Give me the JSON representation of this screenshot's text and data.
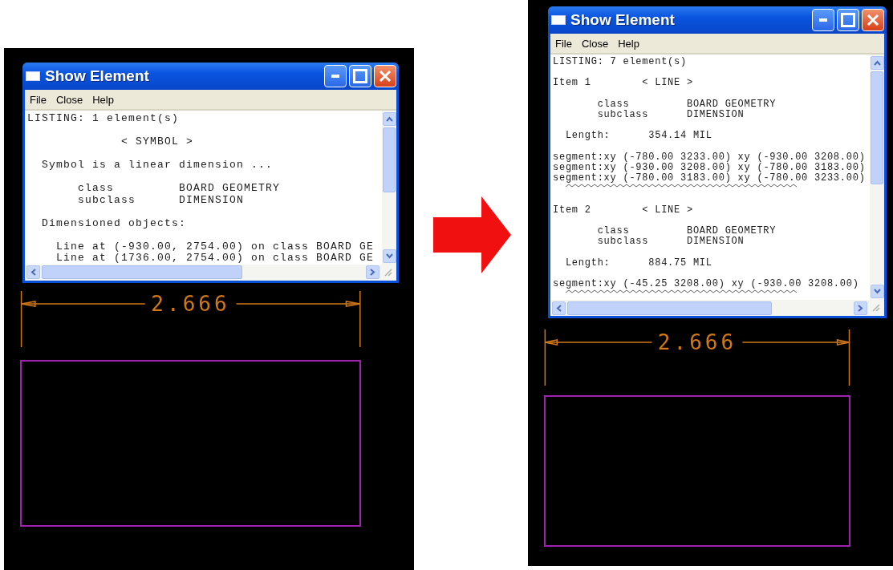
{
  "panels": [
    {
      "window": {
        "title": "Show Element",
        "menu": [
          "File",
          "Close",
          "Help"
        ],
        "lines": [
          {
            "kind": "plain",
            "text": "LISTING: 1 element(s)"
          },
          {
            "kind": "blank"
          },
          {
            "kind": "center",
            "text": "< SYMBOL >"
          },
          {
            "kind": "blank"
          },
          {
            "kind": "note",
            "text": "Symbol is a linear dimension ..."
          },
          {
            "kind": "blank"
          },
          {
            "kind": "pair",
            "label": "class",
            "value": "BOARD GEOMETRY"
          },
          {
            "kind": "pair",
            "label": "subclass",
            "value": "DIMENSION"
          },
          {
            "kind": "blank"
          },
          {
            "kind": "note",
            "text": "Dimensioned objects:"
          },
          {
            "kind": "blank"
          },
          {
            "kind": "deep",
            "text": "Line at (-930.00, 2754.00) on class BOARD GE"
          },
          {
            "kind": "deep",
            "text": "Line at (1736.00, 2754.00) on class BOARD GE"
          }
        ]
      },
      "dimension": "2.666"
    },
    {
      "window": {
        "title": "Show Element",
        "menu": [
          "File",
          "Close",
          "Help"
        ],
        "lines": [
          {
            "kind": "plain",
            "text": "LISTING: 7 element(s)"
          },
          {
            "kind": "blank"
          },
          {
            "kind": "item",
            "label": "Item 1",
            "tag": "< LINE >"
          },
          {
            "kind": "blank"
          },
          {
            "kind": "pair",
            "label": "class",
            "value": "BOARD GEOMETRY"
          },
          {
            "kind": "pair",
            "label": "subclass",
            "value": "DIMENSION"
          },
          {
            "kind": "blank"
          },
          {
            "kind": "measure",
            "label": "Length:",
            "value": "354.14 MIL"
          },
          {
            "kind": "blank"
          },
          {
            "kind": "plain",
            "text": "segment:xy (-780.00 3233.00) xy (-930.00 3208.00)"
          },
          {
            "kind": "plain",
            "text": "segment:xy (-930.00 3208.00) xy (-780.00 3183.00)"
          },
          {
            "kind": "plain",
            "text": "segment:xy (-780.00 3183.00) xy (-780.00 3233.00)"
          },
          {
            "kind": "squiggle"
          },
          {
            "kind": "blank"
          },
          {
            "kind": "item",
            "label": "Item 2",
            "tag": "< LINE >"
          },
          {
            "kind": "blank"
          },
          {
            "kind": "pair",
            "label": "class",
            "value": "BOARD GEOMETRY"
          },
          {
            "kind": "pair",
            "label": "subclass",
            "value": "DIMENSION"
          },
          {
            "kind": "blank"
          },
          {
            "kind": "measure",
            "label": "Length:",
            "value": "884.75 MIL"
          },
          {
            "kind": "blank"
          },
          {
            "kind": "plain",
            "text": "segment:xy (-45.25 3208.00) xy (-930.00 3208.00)"
          },
          {
            "kind": "squiggle"
          }
        ]
      },
      "dimension": "2.666"
    }
  ]
}
